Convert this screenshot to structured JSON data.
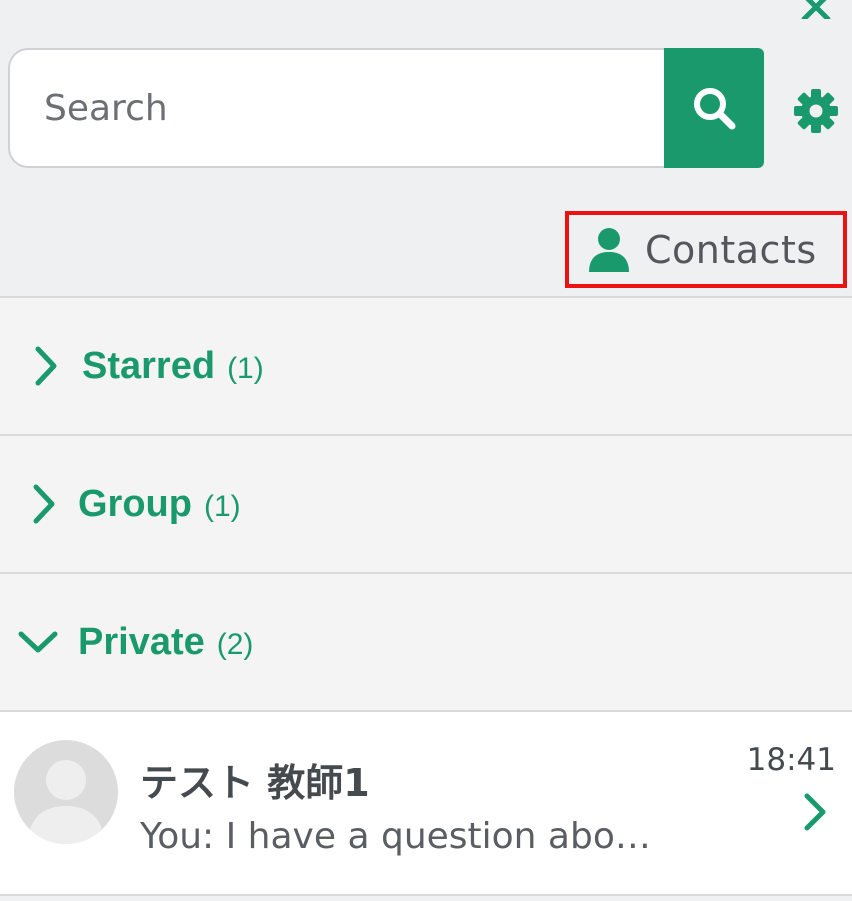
{
  "colors": {
    "accent": "#1a9a6c",
    "highlight_border": "#ee1111",
    "text_dark": "#454a4f"
  },
  "header": {
    "close_icon": "close-icon",
    "search": {
      "placeholder": "Search",
      "value": "",
      "button_icon": "search-icon"
    },
    "settings_icon": "gear-icon",
    "contacts": {
      "icon": "user-icon",
      "label": "Contacts"
    }
  },
  "sections": [
    {
      "label": "Starred",
      "count": "(1)",
      "expanded": false
    },
    {
      "label": "Group",
      "count": "(1)",
      "expanded": false
    },
    {
      "label": "Private",
      "count": "(2)",
      "expanded": true
    }
  ],
  "conversations": [
    {
      "name": "テスト 教師1",
      "time": "18:41",
      "preview": "You: I have a question abo…",
      "avatar_icon": "default-avatar-icon"
    }
  ]
}
